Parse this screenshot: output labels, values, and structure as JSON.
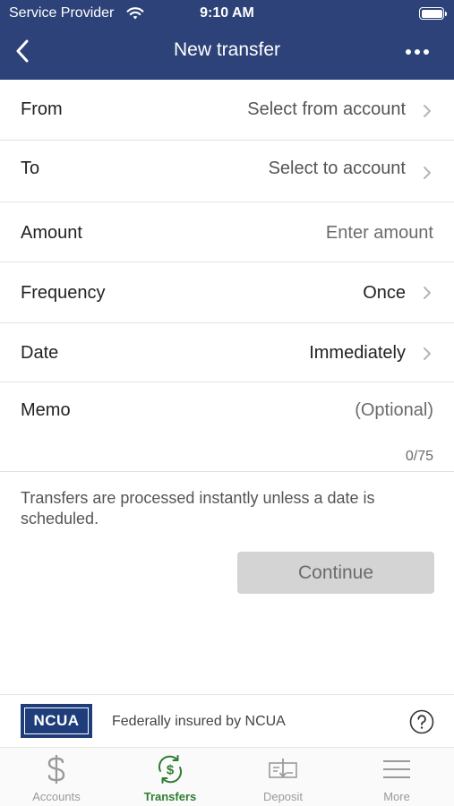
{
  "status_bar": {
    "carrier": "Service Provider",
    "time": "9:10 AM"
  },
  "nav": {
    "title": "New transfer"
  },
  "form": {
    "from": {
      "label": "From",
      "value": "Select from account"
    },
    "to": {
      "label": "To",
      "value": "Select to account"
    },
    "amount": {
      "label": "Amount",
      "placeholder": "Enter amount"
    },
    "frequency": {
      "label": "Frequency",
      "value": "Once"
    },
    "date": {
      "label": "Date",
      "value": "Immediately"
    },
    "memo": {
      "label": "Memo",
      "placeholder": "(Optional)",
      "count": "0/75"
    }
  },
  "info": {
    "text": "Transfers are processed instantly unless a date is scheduled."
  },
  "actions": {
    "continue_label": "Continue"
  },
  "ncua": {
    "logo_text": "NCUA",
    "text": "Federally insured by NCUA"
  },
  "tabs": [
    {
      "label": "Accounts",
      "icon": "dollar-icon"
    },
    {
      "label": "Transfers",
      "icon": "transfer-icon"
    },
    {
      "label": "Deposit",
      "icon": "check-deposit-icon"
    },
    {
      "label": "More",
      "icon": "menu-icon"
    }
  ],
  "colors": {
    "header": "#2c4278",
    "active_tab": "#2e7d32",
    "button_disabled": "#d4d4d4",
    "ncua_blue": "#1f3d7a"
  }
}
